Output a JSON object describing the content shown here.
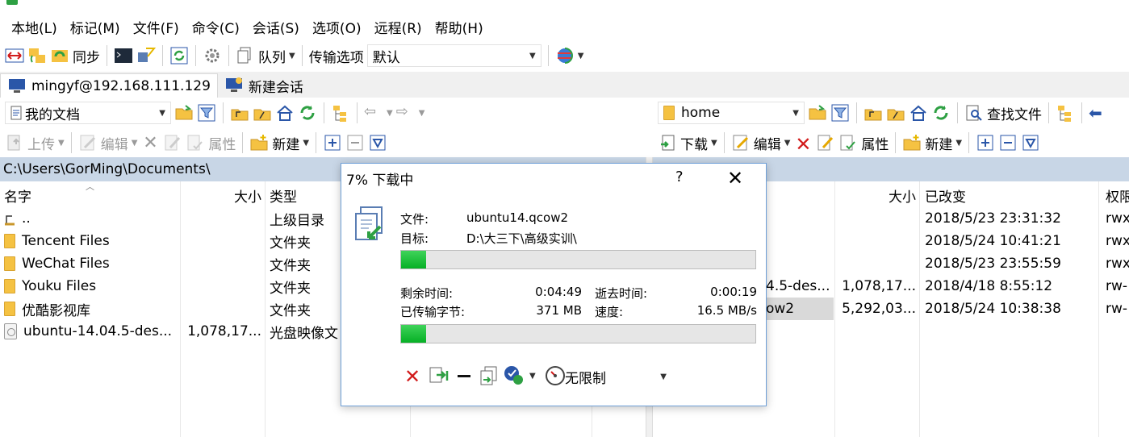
{
  "menu": [
    "本地(L)",
    "标记(M)",
    "文件(F)",
    "命令(C)",
    "会话(S)",
    "选项(O)",
    "远程(R)",
    "帮助(H)"
  ],
  "toolbar": {
    "sync_label": "同步",
    "queue_label": "队列",
    "transfer_options_label": "传输选项",
    "transfer_preset": "默认"
  },
  "tabs": [
    {
      "label": "mingyf@192.168.111.129",
      "active": true
    },
    {
      "label": "新建会话",
      "active": false
    }
  ],
  "left": {
    "location": "我的文档",
    "toolbar": {
      "upload": "上传",
      "edit": "编辑",
      "properties": "属性",
      "new": "新建"
    },
    "path": "C:\\Users\\GorMing\\Documents\\",
    "columns": {
      "name": "名字",
      "size": "大小",
      "type": "类型"
    },
    "rows": [
      {
        "name": "..",
        "size": "",
        "type": "上级目录",
        "icon": "parent-dir-icon"
      },
      {
        "name": "Tencent Files",
        "size": "",
        "type": "文件夹",
        "icon": "folder-icon"
      },
      {
        "name": "WeChat Files",
        "size": "",
        "type": "文件夹",
        "icon": "folder-icon"
      },
      {
        "name": "Youku Files",
        "size": "",
        "type": "文件夹",
        "icon": "folder-icon"
      },
      {
        "name": "优酷影视库",
        "size": "",
        "type": "文件夹",
        "icon": "folder-icon"
      },
      {
        "name": "ubuntu-14.04.5-des...",
        "size": "1,078,17...",
        "type": "光盘映像文",
        "icon": "disc-image-icon"
      }
    ]
  },
  "right": {
    "location": "home",
    "toolbar": {
      "find": "查找文件",
      "download": "下载",
      "edit": "编辑",
      "properties": "属性",
      "new": "新建"
    },
    "columns": {
      "size": "大小",
      "modified": "已改变",
      "perm": "权限"
    },
    "rows": [
      {
        "name": "",
        "size": "",
        "modified": "2018/5/23 23:31:32",
        "perm": "rwx"
      },
      {
        "name": "",
        "size": "",
        "modified": "2018/5/24 10:41:21",
        "perm": "rwx"
      },
      {
        "name": "",
        "size": "",
        "modified": "2018/5/23 23:55:59",
        "perm": "rwx"
      },
      {
        "name": "4.5-des...",
        "size": "1,078,17...",
        "modified": "2018/4/18 8:55:12",
        "perm": "rw-"
      },
      {
        "name": "ow2",
        "size": "5,292,03...",
        "modified": "2018/5/24 10:38:38",
        "perm": "rw-"
      }
    ]
  },
  "dialog": {
    "title": "7% 下载中",
    "help": "?",
    "close": "✕",
    "file_label": "文件:",
    "file_value": "ubuntu14.qcow2",
    "target_label": "目标:",
    "target_value": "D:\\大三下\\高级实训\\",
    "file_progress": 0.07,
    "remaining_label": "剩余时间:",
    "remaining_value": "0:04:49",
    "elapsed_label": "逝去时间:",
    "elapsed_value": "0:00:19",
    "transferred_label": "已传输字节:",
    "transferred_value": "371 MB",
    "speed_label": "速度:",
    "speed_value": "16.5 MB/s",
    "total_progress": 0.07,
    "speed_limit": "无限制"
  }
}
